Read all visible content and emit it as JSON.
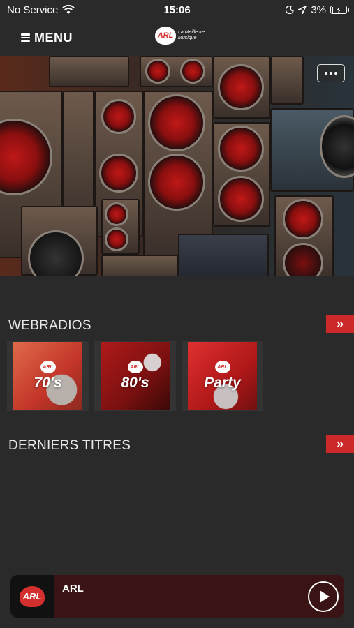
{
  "status_bar": {
    "carrier": "No Service",
    "time": "15:06",
    "battery": "3%"
  },
  "nav": {
    "menu_label": "MENU",
    "logo_text": "ARL",
    "logo_tagline_1": "La Meilleure",
    "logo_tagline_2": "Musique"
  },
  "hero": {
    "more_icon": "ellipsis-icon"
  },
  "webradios": {
    "title": "WEBRADIOS",
    "arrow": "»",
    "items": [
      {
        "logo": "ARL",
        "label": "70's"
      },
      {
        "logo": "ARL",
        "label": "80's"
      },
      {
        "logo": "ARL",
        "label": "Party"
      }
    ]
  },
  "derniers_titres": {
    "title": "DERNIERS TITRES",
    "arrow": "»"
  },
  "player": {
    "logo": "ARL",
    "title": "ARL"
  },
  "colors": {
    "background": "#2a2a2a",
    "accent": "#cc2a2a"
  }
}
